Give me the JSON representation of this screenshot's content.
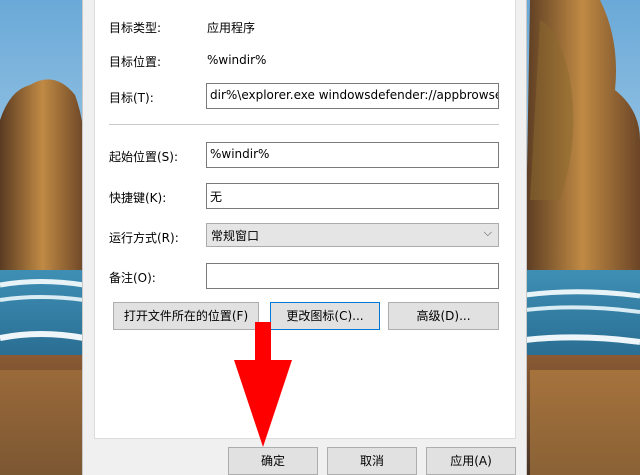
{
  "properties": {
    "target_type_label": "目标类型:",
    "target_type_value": "应用程序",
    "target_location_label": "目标位置:",
    "target_location_value": "%windir%",
    "target_label": "目标(T):",
    "target_value": "dir%\\explorer.exe windowsdefender://appbrowser",
    "start_in_label": "起始位置(S):",
    "start_in_value": "%windir%",
    "shortcut_key_label": "快捷键(K):",
    "shortcut_key_value": "无",
    "run_label": "运行方式(R):",
    "run_value": "常规窗口",
    "comment_label": "备注(O):",
    "comment_value": ""
  },
  "buttons": {
    "open_location": "打开文件所在的位置(F)",
    "change_icon": "更改图标(C)...",
    "advanced": "高级(D)..."
  },
  "footer": {
    "ok": "确定",
    "cancel": "取消",
    "apply": "应用(A)"
  },
  "annotation": {
    "arrow_color": "#ff0000"
  }
}
